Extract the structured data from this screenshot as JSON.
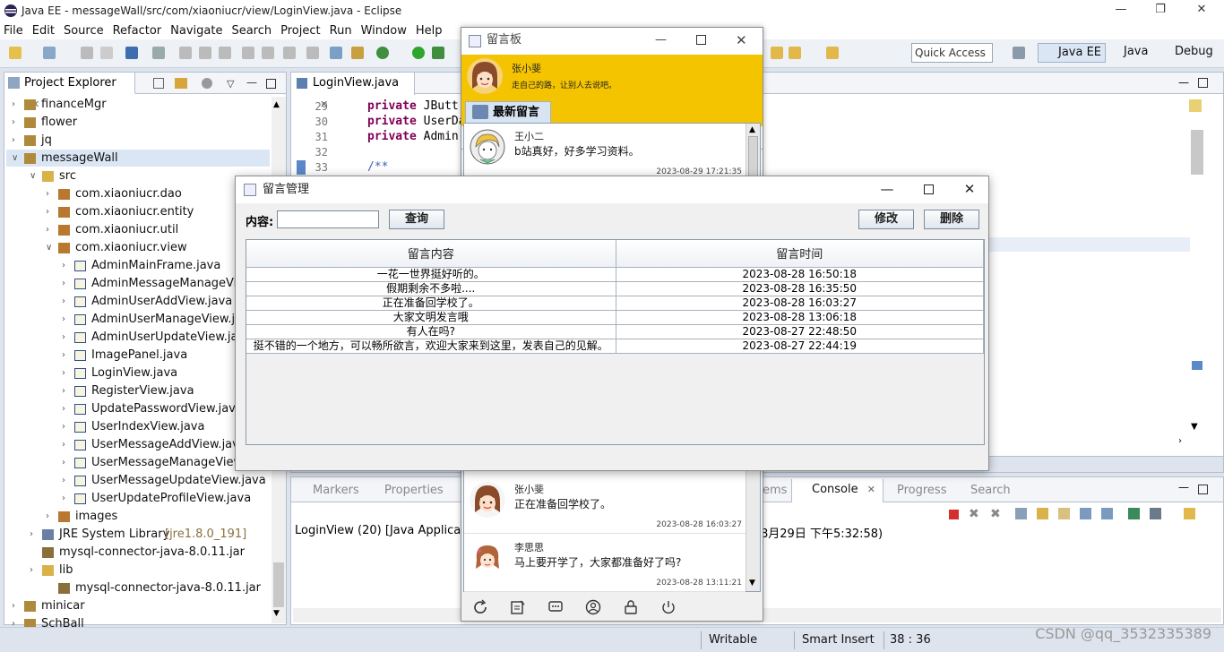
{
  "eclipse": {
    "title": "Java EE - messageWall/src/com/xiaoniucr/view/LoginView.java - Eclipse",
    "menu": [
      "File",
      "Edit",
      "Source",
      "Refactor",
      "Navigate",
      "Search",
      "Project",
      "Run",
      "Window",
      "Help"
    ],
    "quick_access": "Quick Access",
    "perspectives": [
      "Java EE",
      "Java",
      "Debug"
    ]
  },
  "explorer": {
    "tab": "Project Explorer",
    "items": [
      {
        "label": "financeMgr",
        "level": 0,
        "kind": "project"
      },
      {
        "label": "flower",
        "level": 0,
        "kind": "project"
      },
      {
        "label": "jq",
        "level": 0,
        "kind": "project"
      },
      {
        "label": "messageWall",
        "level": 0,
        "kind": "project"
      },
      {
        "label": "src",
        "level": 1,
        "kind": "folder"
      },
      {
        "label": "com.xiaoniucr.dao",
        "level": 2,
        "kind": "package"
      },
      {
        "label": "com.xiaoniucr.entity",
        "level": 2,
        "kind": "package"
      },
      {
        "label": "com.xiaoniucr.util",
        "level": 2,
        "kind": "package"
      },
      {
        "label": "com.xiaoniucr.view",
        "level": 2,
        "kind": "package"
      },
      {
        "label": "AdminMainFrame.java",
        "level": 3,
        "kind": "java"
      },
      {
        "label": "AdminMessageManageView",
        "level": 3,
        "kind": "java"
      },
      {
        "label": "AdminUserAddView.java",
        "level": 3,
        "kind": "java"
      },
      {
        "label": "AdminUserManageView.java",
        "level": 3,
        "kind": "java"
      },
      {
        "label": "AdminUserUpdateView.java",
        "level": 3,
        "kind": "java"
      },
      {
        "label": "ImagePanel.java",
        "level": 3,
        "kind": "java"
      },
      {
        "label": "LoginView.java",
        "level": 3,
        "kind": "java"
      },
      {
        "label": "RegisterView.java",
        "level": 3,
        "kind": "java"
      },
      {
        "label": "UpdatePasswordView.java",
        "level": 3,
        "kind": "java"
      },
      {
        "label": "UserIndexView.java",
        "level": 3,
        "kind": "java"
      },
      {
        "label": "UserMessageAddView.java",
        "level": 3,
        "kind": "java"
      },
      {
        "label": "UserMessageManageView",
        "level": 3,
        "kind": "java"
      },
      {
        "label": "UserMessageUpdateView.java",
        "level": 3,
        "kind": "java"
      },
      {
        "label": "UserUpdateProfileView.java",
        "level": 3,
        "kind": "java"
      },
      {
        "label": "images",
        "level": 2,
        "kind": "package"
      },
      {
        "label": "JRE System Library",
        "suffix": "[jre1.8.0_191]",
        "level": 1,
        "kind": "lib"
      },
      {
        "label": "mysql-connector-java-8.0.11.jar",
        "level": 1,
        "kind": "jar"
      },
      {
        "label": "lib",
        "level": 1,
        "kind": "folder"
      },
      {
        "label": "mysql-connector-java-8.0.11.jar",
        "level": 2,
        "kind": "jar"
      },
      {
        "label": "minicar",
        "level": 0,
        "kind": "project"
      },
      {
        "label": "SchBall",
        "level": 0,
        "kind": "project"
      }
    ]
  },
  "editor": {
    "tab": "LoginView.java",
    "line_numbers": [
      "29",
      "30",
      "31",
      "32",
      "33"
    ],
    "lines": [
      {
        "kw": "private",
        "rest": "JButt"
      },
      {
        "kw": "private",
        "rest": "UserDa"
      },
      {
        "kw": "private",
        "rest": "Admin"
      },
      {
        "kw": "",
        "rest": ""
      },
      {
        "kw": "",
        "rest": "/**"
      }
    ]
  },
  "console": {
    "tabs": [
      "Markers",
      "Properties",
      "ems",
      "Console",
      "Progress",
      "Search"
    ],
    "line_left": "LoginView (20) [Java Application",
    "line_right": "8月29日 下午5:32:58)"
  },
  "status": {
    "writable": "Writable",
    "insert": "Smart Insert",
    "position": "38 : 36"
  },
  "wall": {
    "title": "留言板",
    "user_name": "张小斐",
    "user_motto": "走自己的路，让别人去说吧。",
    "tab": "最新留言",
    "messages": [
      {
        "name": "王小二",
        "content": "b站真好，好多学习资料。",
        "time": "2023-08-29 17:21:35"
      },
      {
        "name": "张小斐",
        "content": "正在准备回学校了。",
        "time": "2023-08-28 16:03:27"
      },
      {
        "name": "李思思",
        "content": "马上要开学了，大家都准备好了吗?",
        "time": "2023-08-28 13:11:21"
      }
    ]
  },
  "dialog": {
    "title": "留言管理",
    "content_label": "内容:",
    "search_value": "",
    "query_button": "查询",
    "edit_button": "修改",
    "delete_button": "删除",
    "columns": [
      "留言内容",
      "留言时间"
    ],
    "rows": [
      [
        "一花一世界挺好听的。",
        "2023-08-28 16:50:18"
      ],
      [
        "假期剩余不多啦....",
        "2023-08-28 16:35:50"
      ],
      [
        "正在准备回学校了。",
        "2023-08-28 16:03:27"
      ],
      [
        "大家文明发言哦",
        "2023-08-28 13:06:18"
      ],
      [
        "有人在吗?",
        "2023-08-27 22:48:50"
      ],
      [
        "挺不错的一个地方，可以畅所欲言，欢迎大家来到这里，发表自己的见解。",
        "2023-08-27 22:44:19"
      ]
    ]
  },
  "watermark": "CSDN @qq_3532335389",
  "colors": {
    "header_yellow": "#f4c400",
    "selection": "#dbe6f5"
  }
}
